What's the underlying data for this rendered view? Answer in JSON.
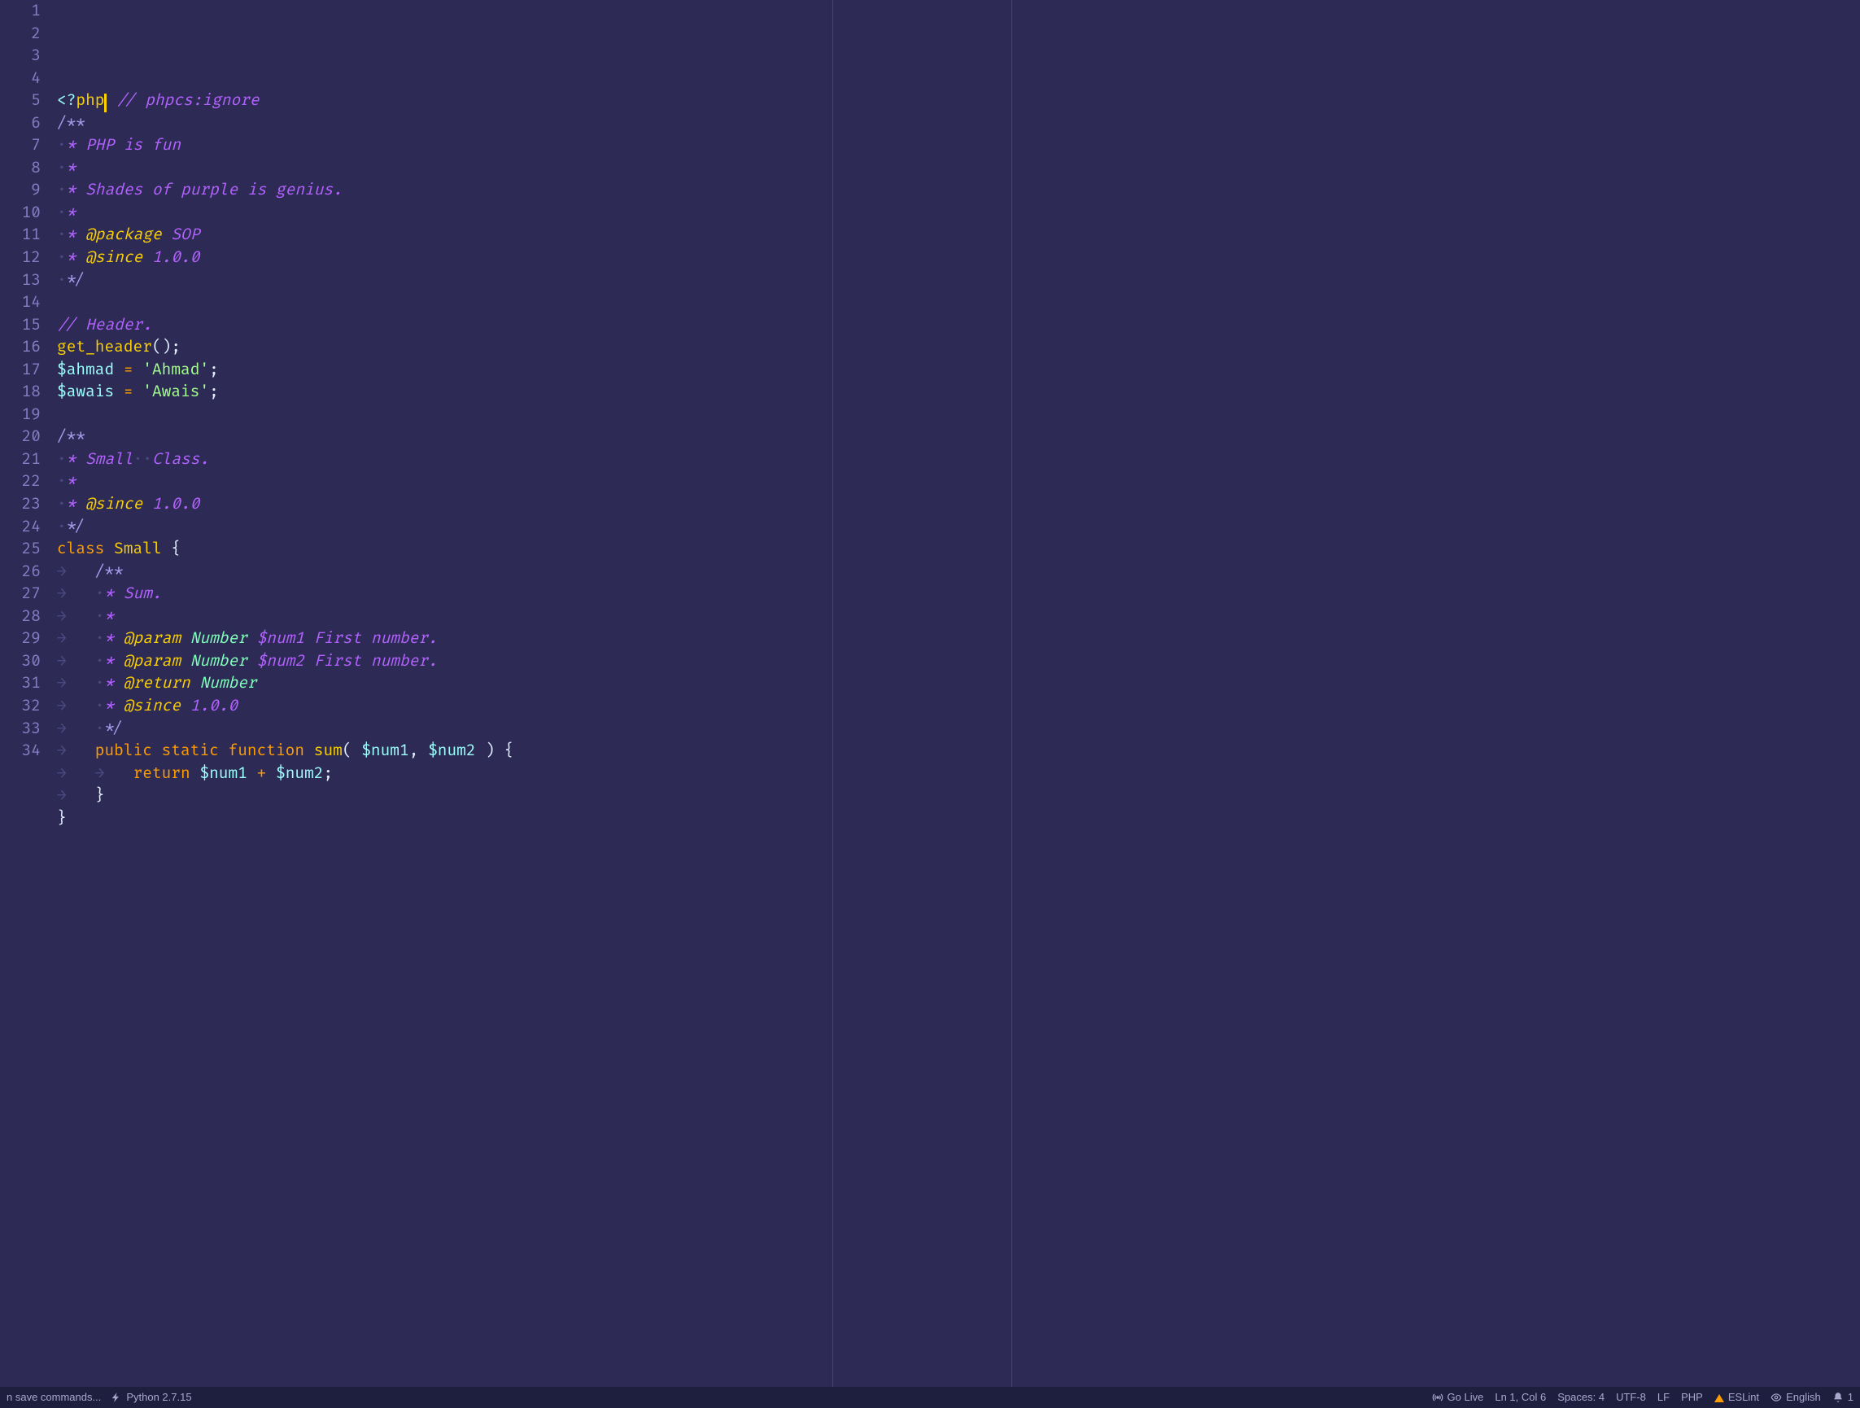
{
  "gutter": {
    "start": 1,
    "end": 34
  },
  "code": {
    "lines": [
      {
        "tokens": [
          {
            "t": "<?",
            "c": "tok-tag"
          },
          {
            "t": "php",
            "c": "tok-fn"
          },
          {
            "t": "CURSOR"
          },
          {
            "t": " ",
            "c": ""
          },
          {
            "t": "// phpcs:ignore",
            "c": "tok-comment"
          }
        ]
      },
      {
        "tokens": [
          {
            "t": "/**",
            "c": "tok-commstar non-ital"
          }
        ]
      },
      {
        "tokens": [
          {
            "t": "·",
            "c": "ws-dot"
          },
          {
            "t": "* PHP is fun",
            "c": "tok-comment"
          }
        ]
      },
      {
        "tokens": [
          {
            "t": "·",
            "c": "ws-dot"
          },
          {
            "t": "*",
            "c": "tok-comment"
          }
        ]
      },
      {
        "tokens": [
          {
            "t": "·",
            "c": "ws-dot"
          },
          {
            "t": "* Shades of purple is genius.",
            "c": "tok-comment"
          }
        ]
      },
      {
        "tokens": [
          {
            "t": "·",
            "c": "ws-dot"
          },
          {
            "t": "*",
            "c": "tok-comment"
          }
        ]
      },
      {
        "tokens": [
          {
            "t": "·",
            "c": "ws-dot"
          },
          {
            "t": "* ",
            "c": "tok-comment"
          },
          {
            "t": "@package",
            "c": "tok-doctag"
          },
          {
            "t": " SOP",
            "c": "tok-comment"
          }
        ]
      },
      {
        "tokens": [
          {
            "t": "·",
            "c": "ws-dot"
          },
          {
            "t": "* ",
            "c": "tok-comment"
          },
          {
            "t": "@since",
            "c": "tok-doctag"
          },
          {
            "t": " 1.0.0",
            "c": "tok-comment"
          }
        ]
      },
      {
        "tokens": [
          {
            "t": "·",
            "c": "ws-dot"
          },
          {
            "t": "*/",
            "c": "tok-commstar non-ital"
          }
        ]
      },
      {
        "tokens": []
      },
      {
        "tokens": [
          {
            "t": "// Header.",
            "c": "tok-comment"
          }
        ]
      },
      {
        "tokens": [
          {
            "t": "get_header",
            "c": "tok-fn"
          },
          {
            "t": "();",
            "c": "tok-punc"
          }
        ]
      },
      {
        "tokens": [
          {
            "t": "$ahmad",
            "c": "tok-var"
          },
          {
            "t": " ",
            "c": ""
          },
          {
            "t": "=",
            "c": "tok-op"
          },
          {
            "t": " ",
            "c": ""
          },
          {
            "t": "'Ahmad'",
            "c": "tok-str"
          },
          {
            "t": ";",
            "c": "tok-punc"
          }
        ]
      },
      {
        "tokens": [
          {
            "t": "$awais",
            "c": "tok-var"
          },
          {
            "t": " ",
            "c": ""
          },
          {
            "t": "=",
            "c": "tok-op"
          },
          {
            "t": " ",
            "c": ""
          },
          {
            "t": "'Awais'",
            "c": "tok-str"
          },
          {
            "t": ";",
            "c": "tok-punc"
          }
        ]
      },
      {
        "tokens": []
      },
      {
        "tokens": [
          {
            "t": "/**",
            "c": "tok-commstar non-ital"
          }
        ]
      },
      {
        "tokens": [
          {
            "t": "·",
            "c": "ws-dot"
          },
          {
            "t": "* Small",
            "c": "tok-comment"
          },
          {
            "t": "··",
            "c": "ws-dot"
          },
          {
            "t": "Class.",
            "c": "tok-comment"
          }
        ]
      },
      {
        "tokens": [
          {
            "t": "·",
            "c": "ws-dot"
          },
          {
            "t": "*",
            "c": "tok-comment"
          }
        ]
      },
      {
        "tokens": [
          {
            "t": "·",
            "c": "ws-dot"
          },
          {
            "t": "* ",
            "c": "tok-comment"
          },
          {
            "t": "@since",
            "c": "tok-doctag"
          },
          {
            "t": " 1.0.0",
            "c": "tok-comment"
          }
        ]
      },
      {
        "tokens": [
          {
            "t": "·",
            "c": "ws-dot"
          },
          {
            "t": "*/",
            "c": "tok-commstar non-ital"
          }
        ]
      },
      {
        "tokens": [
          {
            "t": "class",
            "c": "tok-kw"
          },
          {
            "t": " ",
            "c": ""
          },
          {
            "t": "Small",
            "c": "tok-class"
          },
          {
            "t": " ",
            "c": ""
          },
          {
            "t": "{",
            "c": "tok-punc"
          }
        ]
      },
      {
        "tokens": [
          {
            "t": "→",
            "c": "ws-arr"
          },
          {
            "t": "   ",
            "c": ""
          },
          {
            "t": "/**",
            "c": "tok-commstar non-ital"
          }
        ]
      },
      {
        "tokens": [
          {
            "t": "→",
            "c": "ws-arr"
          },
          {
            "t": "   ",
            "c": ""
          },
          {
            "t": "·",
            "c": "ws-dot"
          },
          {
            "t": "* Sum.",
            "c": "tok-comment"
          }
        ]
      },
      {
        "tokens": [
          {
            "t": "→",
            "c": "ws-arr"
          },
          {
            "t": "   ",
            "c": ""
          },
          {
            "t": "·",
            "c": "ws-dot"
          },
          {
            "t": "*",
            "c": "tok-comment"
          }
        ]
      },
      {
        "tokens": [
          {
            "t": "→",
            "c": "ws-arr"
          },
          {
            "t": "   ",
            "c": ""
          },
          {
            "t": "·",
            "c": "ws-dot"
          },
          {
            "t": "* ",
            "c": "tok-comment"
          },
          {
            "t": "@param",
            "c": "tok-doctag"
          },
          {
            "t": " ",
            "c": ""
          },
          {
            "t": "Number",
            "c": "tok-type"
          },
          {
            "t": " $num1 First number.",
            "c": "tok-comment"
          }
        ]
      },
      {
        "tokens": [
          {
            "t": "→",
            "c": "ws-arr"
          },
          {
            "t": "   ",
            "c": ""
          },
          {
            "t": "·",
            "c": "ws-dot"
          },
          {
            "t": "* ",
            "c": "tok-comment"
          },
          {
            "t": "@param",
            "c": "tok-doctag"
          },
          {
            "t": " ",
            "c": ""
          },
          {
            "t": "Number",
            "c": "tok-type"
          },
          {
            "t": " $num2 First number.",
            "c": "tok-comment"
          }
        ]
      },
      {
        "tokens": [
          {
            "t": "→",
            "c": "ws-arr"
          },
          {
            "t": "   ",
            "c": ""
          },
          {
            "t": "·",
            "c": "ws-dot"
          },
          {
            "t": "* ",
            "c": "tok-comment"
          },
          {
            "t": "@return",
            "c": "tok-doctag"
          },
          {
            "t": " ",
            "c": ""
          },
          {
            "t": "Number",
            "c": "tok-type"
          }
        ]
      },
      {
        "tokens": [
          {
            "t": "→",
            "c": "ws-arr"
          },
          {
            "t": "   ",
            "c": ""
          },
          {
            "t": "·",
            "c": "ws-dot"
          },
          {
            "t": "* ",
            "c": "tok-comment"
          },
          {
            "t": "@since",
            "c": "tok-doctag"
          },
          {
            "t": " 1.0.0",
            "c": "tok-comment"
          }
        ]
      },
      {
        "tokens": [
          {
            "t": "→",
            "c": "ws-arr"
          },
          {
            "t": "   ",
            "c": ""
          },
          {
            "t": "·",
            "c": "ws-dot"
          },
          {
            "t": "*/",
            "c": "tok-commstar non-ital"
          }
        ]
      },
      {
        "tokens": [
          {
            "t": "→",
            "c": "ws-arr"
          },
          {
            "t": "   ",
            "c": ""
          },
          {
            "t": "public",
            "c": "tok-kw"
          },
          {
            "t": " ",
            "c": ""
          },
          {
            "t": "static",
            "c": "tok-kw"
          },
          {
            "t": " ",
            "c": ""
          },
          {
            "t": "function",
            "c": "tok-kw"
          },
          {
            "t": " ",
            "c": ""
          },
          {
            "t": "sum",
            "c": "tok-fn"
          },
          {
            "t": "( ",
            "c": "tok-punc"
          },
          {
            "t": "$num1",
            "c": "tok-var"
          },
          {
            "t": ", ",
            "c": "tok-punc"
          },
          {
            "t": "$num2",
            "c": "tok-var"
          },
          {
            "t": " ) {",
            "c": "tok-punc"
          }
        ]
      },
      {
        "tokens": [
          {
            "t": "→",
            "c": "ws-arr"
          },
          {
            "t": "   ",
            "c": ""
          },
          {
            "t": "→",
            "c": "ws-arr"
          },
          {
            "t": "   ",
            "c": ""
          },
          {
            "t": "return",
            "c": "tok-kw"
          },
          {
            "t": " ",
            "c": ""
          },
          {
            "t": "$num1",
            "c": "tok-var"
          },
          {
            "t": " ",
            "c": ""
          },
          {
            "t": "+",
            "c": "tok-op"
          },
          {
            "t": " ",
            "c": ""
          },
          {
            "t": "$num2",
            "c": "tok-var"
          },
          {
            "t": ";",
            "c": "tok-punc"
          }
        ]
      },
      {
        "tokens": [
          {
            "t": "→",
            "c": "ws-arr"
          },
          {
            "t": "   ",
            "c": ""
          },
          {
            "t": "}",
            "c": "tok-punc"
          }
        ]
      },
      {
        "tokens": [
          {
            "t": "}",
            "c": "tok-punc"
          }
        ]
      },
      {
        "tokens": []
      }
    ]
  },
  "statusbar": {
    "save_commands": "n save commands...",
    "python": "Python 2.7.15",
    "go_live": "Go Live",
    "cursor": "Ln 1, Col 6",
    "spaces": "Spaces: 4",
    "encoding": "UTF-8",
    "eol": "LF",
    "language": "PHP",
    "eslint": "ESLint",
    "spell": "English",
    "bell": "1"
  }
}
